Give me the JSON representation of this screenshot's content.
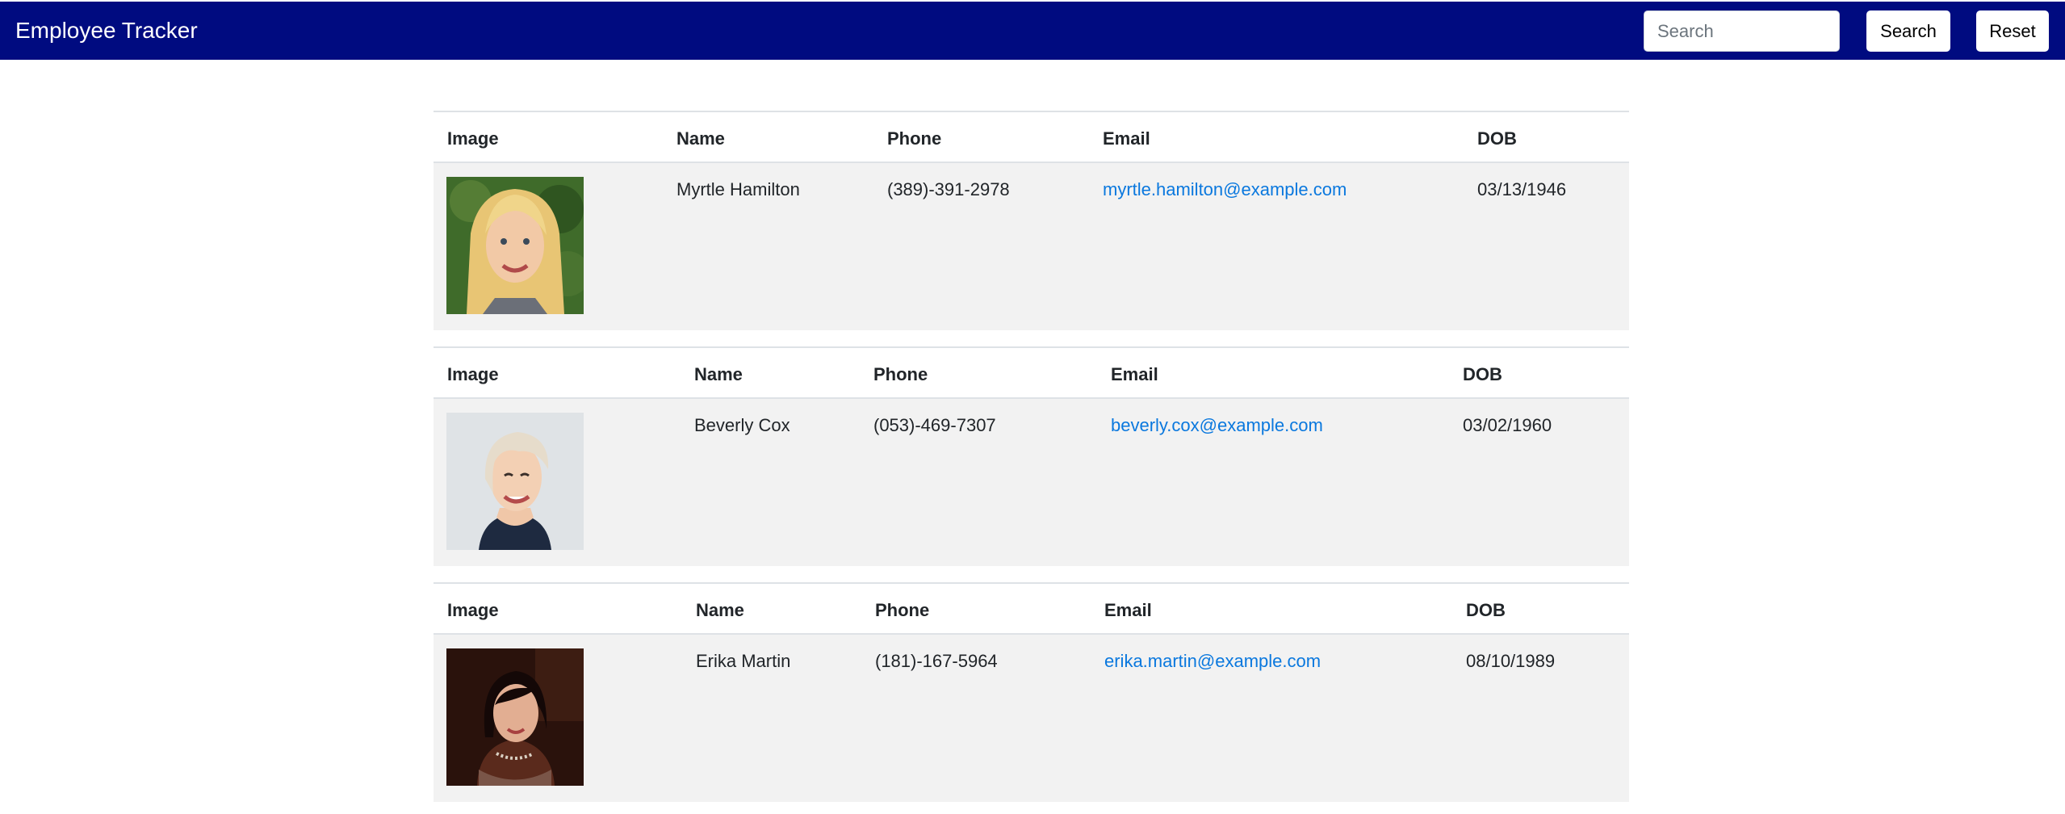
{
  "app": {
    "title": "Employee Tracker"
  },
  "search": {
    "placeholder": "Search",
    "value": "",
    "button_label": "Search",
    "reset_label": "Reset"
  },
  "table": {
    "headers": {
      "image": "Image",
      "name": "Name",
      "phone": "Phone",
      "email": "Email",
      "dob": "DOB"
    },
    "rows": [
      {
        "name": "Myrtle Hamilton",
        "phone": "(389)-391-2978",
        "email": "myrtle.hamilton@example.com",
        "dob": "03/13/1946",
        "image_icon": "portrait-photo"
      },
      {
        "name": "Beverly Cox",
        "phone": "(053)-469-7307",
        "email": "beverly.cox@example.com",
        "dob": "03/02/1960",
        "image_icon": "portrait-photo"
      },
      {
        "name": "Erika Martin",
        "phone": "(181)-167-5964",
        "email": "erika.martin@example.com",
        "dob": "08/10/1989",
        "image_icon": "portrait-photo"
      }
    ]
  },
  "colors": {
    "navbar": "#000b80",
    "link": "#0a78de",
    "row_background": "#f2f2f2"
  }
}
